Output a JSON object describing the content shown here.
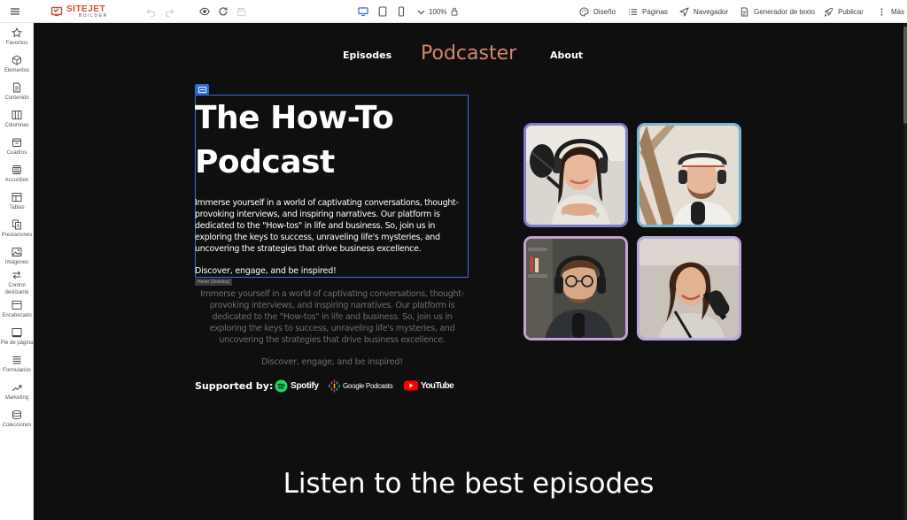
{
  "toolbar": {
    "logo_main": "SITEJET",
    "logo_sub": "BUILDER",
    "zoom": "100%",
    "buttons": {
      "diseno": "Diseño",
      "paginas": "Páginas",
      "navegador": "Navegador",
      "generador": "Generador de texto",
      "publicar": "Publicar",
      "mas": "Más"
    }
  },
  "sidebar": {
    "items": [
      {
        "label": "Favoritos",
        "icon": "star-icon"
      },
      {
        "label": "Elementos",
        "icon": "cube-icon"
      },
      {
        "label": "Contenido",
        "icon": "document-icon"
      },
      {
        "label": "Columnas",
        "icon": "columns-icon"
      },
      {
        "label": "Cuadros",
        "icon": "box-icon"
      },
      {
        "label": "Accordion",
        "icon": "accordion-icon"
      },
      {
        "label": "Tablas",
        "icon": "table-icon"
      },
      {
        "label": "Prestaciones",
        "icon": "features-icon"
      },
      {
        "label": "Imágenes",
        "icon": "image-icon"
      },
      {
        "label": "Control deslizante",
        "icon": "slider-icon"
      },
      {
        "label": "Encabezado",
        "icon": "header-icon"
      },
      {
        "label": "Pie de página",
        "icon": "footer-icon"
      },
      {
        "label": "Formularios",
        "icon": "form-icon"
      },
      {
        "label": "Marketing",
        "icon": "marketing-icon"
      },
      {
        "label": "Colecciones",
        "icon": "collections-icon"
      }
    ]
  },
  "page": {
    "nav": {
      "episodes": "Episodes",
      "brand": "Podcaster",
      "about": "About"
    },
    "hero": {
      "title": "The How-To Podcast",
      "description": "Immerse yourself in a world of captivating conversations, thought-provoking interviews, and inspiring narratives. Our platform is dedicated to the \"How-tos\" in life and business. So, join us in exploring the keys to success, unraveling life's mysteries, and uncovering the strategies that drive business excellence.",
      "cta": "Discover, engage, and be inspired!",
      "hover_tag": "Hover (Desktop)"
    },
    "supported": {
      "label": "Supported by:",
      "brands": [
        "Spotify",
        "Google Podcasts",
        "YouTube"
      ]
    },
    "photo_borders": [
      "#7c7fc9",
      "#7ab5d6",
      "#c4a0d6",
      "#b9a9e0"
    ],
    "section_heading": "Listen to the best episodes"
  },
  "colors": {
    "canvas_bg": "#0f0f0f",
    "brand_accent": "#d7856f",
    "selection": "#3b6fd9",
    "logo": "#d64a2a"
  }
}
